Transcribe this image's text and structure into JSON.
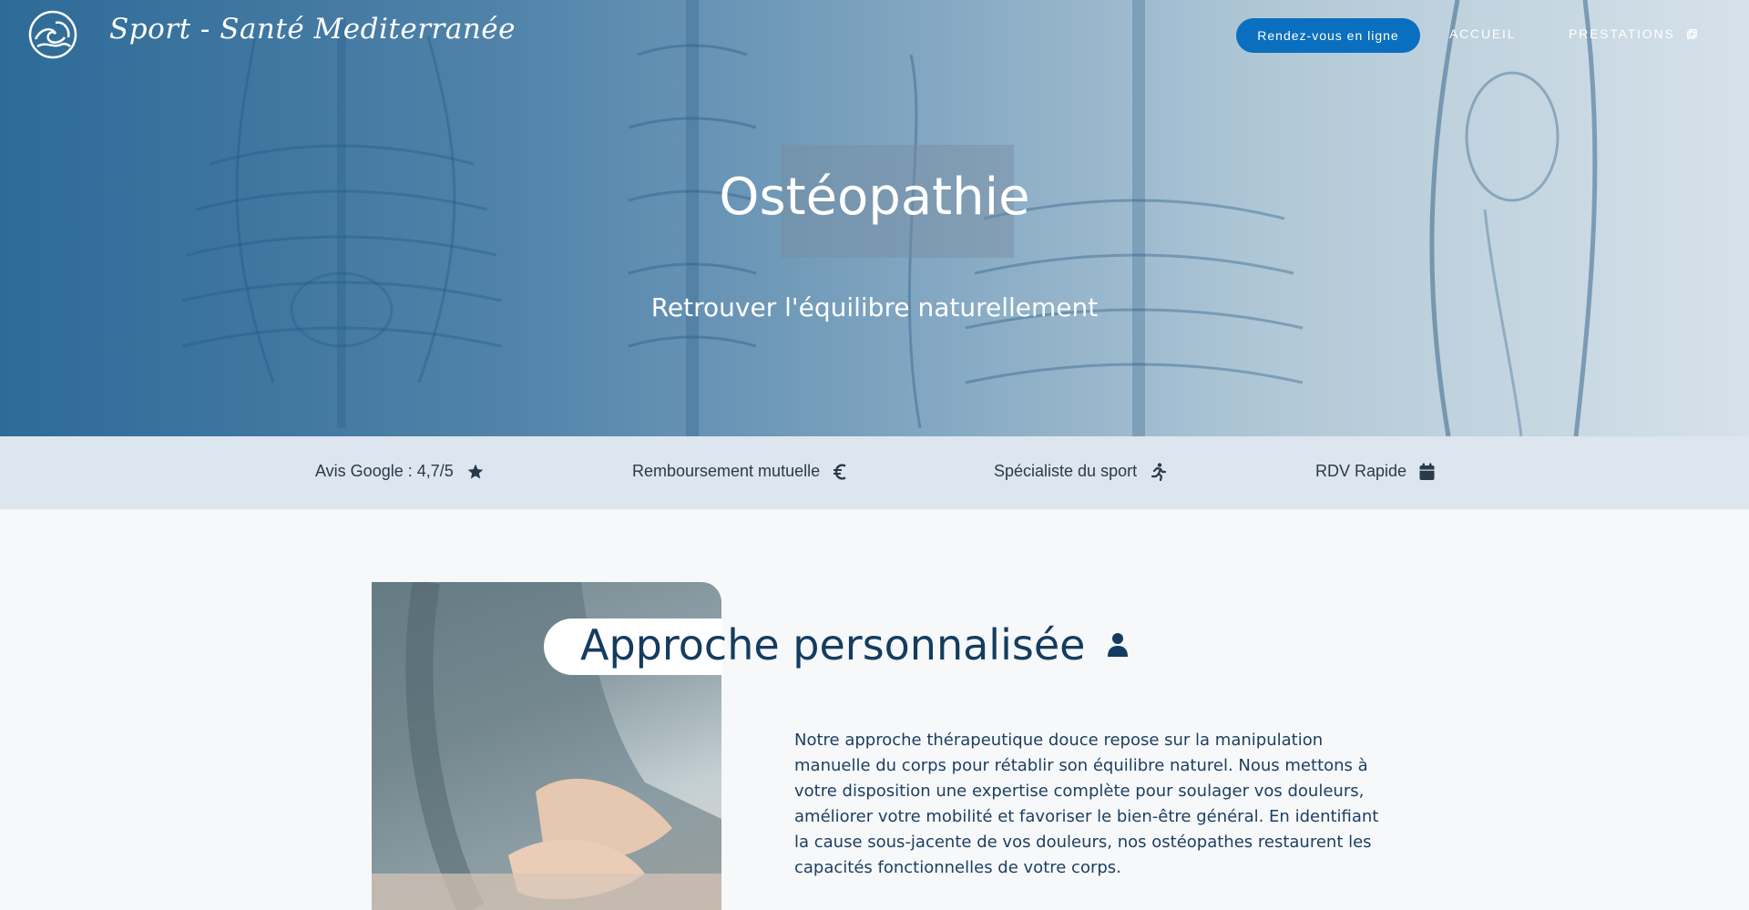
{
  "header": {
    "brand": "Sport - Santé Mediterranée",
    "cta_label": "Rendez-vous en ligne",
    "nav": [
      {
        "label": "ACCUEIL"
      },
      {
        "label": "PRESTATIONS"
      }
    ]
  },
  "hero": {
    "title": "Ostéopathie",
    "subtitle": "Retrouver l'équilibre naturellement"
  },
  "features": [
    {
      "label": "Avis Google : 4,7/5",
      "icon": "star-icon"
    },
    {
      "label": "Remboursement mutuelle",
      "icon": "euro-icon"
    },
    {
      "label": "Spécialiste du sport",
      "icon": "runner-icon"
    },
    {
      "label": "RDV Rapide",
      "icon": "calendar-icon"
    }
  ],
  "section": {
    "title": "Approche personnalisée",
    "icon": "user-icon",
    "description": "Notre approche thérapeutique douce repose sur la manipulation manuelle du corps pour rétablir son équilibre naturel. Nous mettons à votre disposition une expertise complète pour soulager vos douleurs, améliorer votre mobilité et favoriser le bien-être général. En identifiant la cause sous-jacente de vos douleurs, nos ostéopathes restaurent les capacités fonctionnelles de votre corps."
  },
  "colors": {
    "primary": "#0a6fbe",
    "navy": "#143c60",
    "feature_bar": "#dde5ee",
    "background": "#f6f8fa"
  }
}
